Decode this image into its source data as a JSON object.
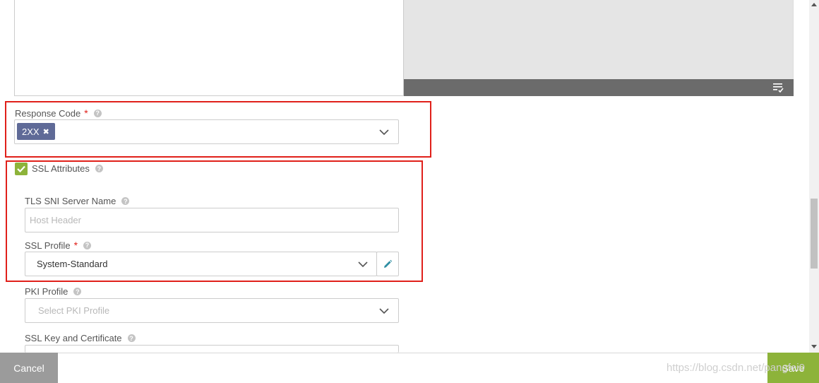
{
  "response_code": {
    "label": "Response Code",
    "required_mark": "*",
    "tag": "2XX",
    "tag_remove": "✖"
  },
  "ssl_attributes": {
    "label": "SSL Attributes",
    "checked": true
  },
  "tls_sni": {
    "label": "TLS SNI Server Name",
    "placeholder": "Host Header"
  },
  "ssl_profile": {
    "label": "SSL Profile",
    "required_mark": "*",
    "value": "System-Standard"
  },
  "pki_profile": {
    "label": "PKI Profile",
    "placeholder": "Select PKI Profile"
  },
  "ssl_key_cert": {
    "label": "SSL Key and Certificate"
  },
  "help_glyph": "?",
  "footer": {
    "cancel_label": "Cancel",
    "save_label": "Save"
  },
  "watermark": "https://blog.csdn.net/pangfei0",
  "colors": {
    "accent_green": "#8db33a",
    "tag_bg": "#5f6a97",
    "highlight_red": "#e0201a",
    "cancel_gray": "#9b9b9b"
  },
  "icons": [
    "help-icon",
    "chevron-down-icon",
    "pencil-icon",
    "checkmark-icon",
    "wrap-text-icon",
    "close-icon"
  ]
}
